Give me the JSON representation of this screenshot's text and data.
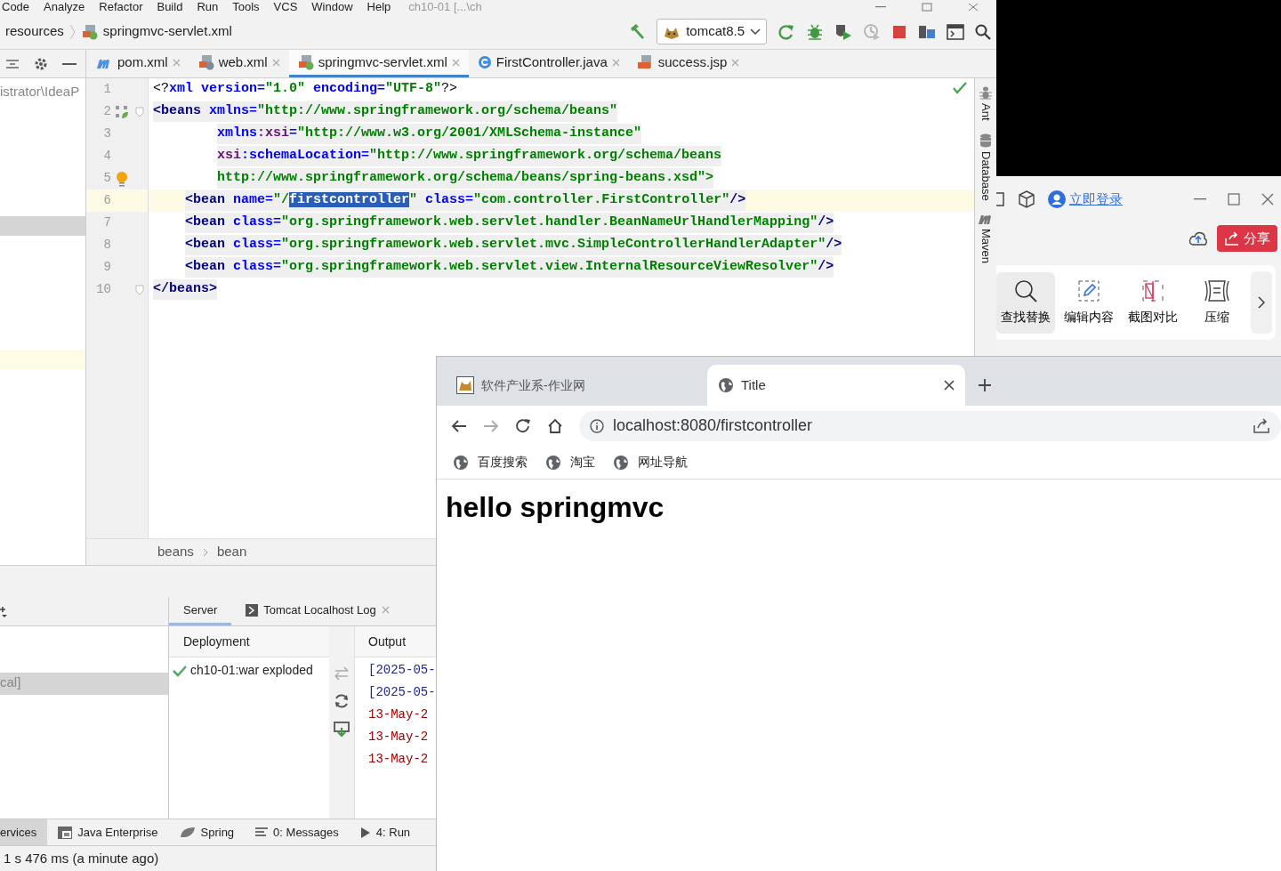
{
  "ide": {
    "menu": [
      "Code",
      "Analyze",
      "Refactor",
      "Build",
      "Run",
      "Tools",
      "VCS",
      "Window",
      "Help"
    ],
    "title": "ch10-01 [...\\ch",
    "nav_path": [
      "resources",
      "springmvc-servlet.xml"
    ],
    "run_config": "tomcat8.5",
    "editor_tabs": [
      {
        "label": "pom.xml",
        "kind": "maven",
        "selected": false
      },
      {
        "label": "web.xml",
        "kind": "xml",
        "selected": false
      },
      {
        "label": "springmvc-servlet.xml",
        "kind": "spring",
        "selected": true
      },
      {
        "label": "FirstController.java",
        "kind": "class",
        "selected": false
      },
      {
        "label": "success.jsp",
        "kind": "jsp",
        "selected": false
      }
    ],
    "project_path": "istrator\\IdeaP",
    "code_lines": [
      {
        "number": "1",
        "kind": "top",
        "tinted": false,
        "current": false,
        "tokens": [
          {
            "text": "<?",
            "kind": "punct"
          },
          {
            "text": "xml",
            "kind": "attr"
          },
          {
            "text": "version=",
            "kind": "attr",
            "spaced": true
          },
          {
            "text": "\"1.0\"",
            "kind": "value"
          },
          {
            "text": "encoding=",
            "kind": "attr",
            "spaced": true
          },
          {
            "text": "\"UTF-8\"",
            "kind": "value"
          },
          {
            "text": "?>",
            "kind": "punct"
          }
        ]
      },
      {
        "number": "2",
        "kind": "top",
        "gutter": {
          "kind": "bean"
        },
        "fold": true,
        "tinted": true,
        "current": false,
        "tokens": [
          {
            "text": "<beans",
            "kind": "tag"
          },
          {
            "text": "xmlns=",
            "kind": "attr",
            "spaced": true
          },
          {
            "text": "\"http://www.springframework.org/schema/beans\"",
            "kind": "value"
          }
        ]
      },
      {
        "number": "3",
        "kind": "attr",
        "tinted": true,
        "current": false,
        "tokens": [
          {
            "text": "xmlns",
            "kind": "attr"
          },
          {
            "text": ":xsi",
            "kind": "ns"
          },
          {
            "text": "=",
            "kind": "attr"
          },
          {
            "text": "\"http://www.w3.org/2001/XMLSchema-instance\"",
            "kind": "value"
          }
        ]
      },
      {
        "number": "4",
        "kind": "attr",
        "tinted": true,
        "current": false,
        "tokens": [
          {
            "text": "xsi",
            "kind": "ns"
          },
          {
            "text": ":schemaLocation=",
            "kind": "attr"
          },
          {
            "text": "\"http://www.springframework.org/schema/beans",
            "kind": "value"
          }
        ]
      },
      {
        "number": "5",
        "kind": "attr",
        "gutter": {
          "kind": "bulb"
        },
        "tinted": true,
        "current": false,
        "tokens": [
          {
            "text": "http://www.springframework.org/schema/beans/spring-beans.xsd\">",
            "kind": "value"
          }
        ]
      },
      {
        "number": "6",
        "kind": "child",
        "tinted": true,
        "current": true,
        "tokens": [
          {
            "text": "<bean",
            "kind": "tag"
          },
          {
            "text": "name=",
            "kind": "attr",
            "spaced": true
          },
          {
            "text": "\"/",
            "kind": "value"
          },
          {
            "text": "firstcontroller",
            "kind": "sel"
          },
          {
            "text": "\"",
            "kind": "value"
          },
          {
            "text": "class=",
            "kind": "attr",
            "spaced": true
          },
          {
            "text": "\"com.controller.FirstController\"",
            "kind": "value"
          },
          {
            "text": "/>",
            "kind": "tag"
          }
        ]
      },
      {
        "number": "7",
        "kind": "child",
        "tinted": true,
        "current": false,
        "tokens": [
          {
            "text": "<bean",
            "kind": "tag"
          },
          {
            "text": "class=",
            "kind": "attr",
            "spaced": true
          },
          {
            "text": "\"org.springframework.web.servlet.handler.BeanNameUrlHandlerMapping\"",
            "kind": "value"
          },
          {
            "text": "/>",
            "kind": "tag"
          }
        ]
      },
      {
        "number": "8",
        "kind": "child",
        "tinted": true,
        "current": false,
        "tokens": [
          {
            "text": "<bean",
            "kind": "tag"
          },
          {
            "text": "class=",
            "kind": "attr",
            "spaced": true
          },
          {
            "text": "\"org.springframework.web.servlet.mvc.SimpleControllerHandlerAdapter\"",
            "kind": "value"
          },
          {
            "text": "/>",
            "kind": "tag"
          }
        ]
      },
      {
        "number": "9",
        "kind": "child",
        "tinted": true,
        "current": false,
        "tokens": [
          {
            "text": "<bean",
            "kind": "tag"
          },
          {
            "text": "class=",
            "kind": "attr",
            "spaced": true
          },
          {
            "text": "\"org.springframework.web.servlet.view.InternalResourceViewResolver\"",
            "kind": "value"
          },
          {
            "text": "/>",
            "kind": "tag"
          }
        ]
      },
      {
        "number": "10",
        "kind": "top",
        "fold": true,
        "tinted": true,
        "current": false,
        "tokens": [
          {
            "text": "</beans>",
            "kind": "tag"
          }
        ]
      }
    ],
    "breadcrumbs": [
      "beans",
      "bean"
    ],
    "side_tools": [
      {
        "label": "Ant",
        "kind": "ant"
      },
      {
        "label": "Database",
        "kind": "database"
      },
      {
        "label": "Maven",
        "kind": "maven"
      }
    ],
    "services": {
      "selected_node": "cal]",
      "tabs": [
        {
          "label": "Server",
          "selected": true
        },
        {
          "label": "Tomcat Localhost Log",
          "selected": false
        }
      ],
      "deployment_header": "Deployment",
      "output_header": "Output",
      "deployment": "ch10-01:war exploded",
      "output_lines": [
        {
          "text": "[2025-05-",
          "kind": "info"
        },
        {
          "text": "[2025-05-",
          "kind": "info"
        },
        {
          "text": "13-May-2",
          "kind": "error"
        },
        {
          "text": "13-May-2",
          "kind": "error"
        },
        {
          "text": "13-May-2",
          "kind": "error"
        }
      ]
    },
    "tool_windows": [
      {
        "label": "ervices",
        "kind": "services",
        "selected": true
      },
      {
        "label": "Java Enterprise",
        "kind": "javaee",
        "selected": false
      },
      {
        "label": "Spring",
        "kind": "spring",
        "selected": false
      },
      {
        "label": "0: Messages",
        "kind": "messages",
        "selected": false
      },
      {
        "label": "4: Run",
        "kind": "run",
        "selected": false
      }
    ],
    "status": "1 s 476 ms (a minute ago)"
  },
  "app_window": {
    "login": "立即登录",
    "share": "分享",
    "tools": [
      {
        "label": "查找替换",
        "kind": "search",
        "selected": true
      },
      {
        "label": "编辑内容",
        "kind": "edit",
        "selected": false
      },
      {
        "label": "截图对比",
        "kind": "compare",
        "selected": false
      },
      {
        "label": "压缩",
        "kind": "compress",
        "selected": false
      }
    ]
  },
  "browser": {
    "tabs": [
      {
        "label": "软件产业系-作业网",
        "kind": "site",
        "selected": false
      },
      {
        "label": "Title",
        "kind": "globe",
        "selected": true
      }
    ],
    "address": "localhost:8080/firstcontroller",
    "bookmarks": [
      "百度搜索",
      "淘宝",
      "网址导航"
    ],
    "heading": "hello springmvc"
  }
}
